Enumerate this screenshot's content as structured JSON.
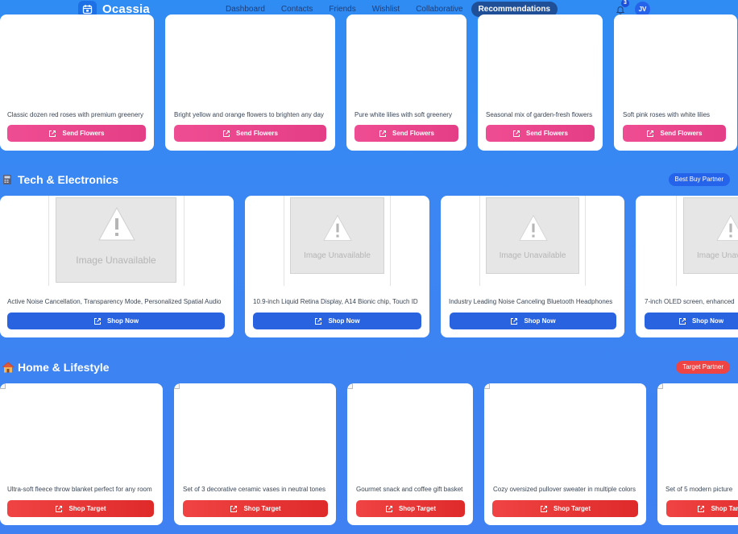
{
  "brand": {
    "name": "Ocassia"
  },
  "nav": {
    "links": [
      "Dashboard",
      "Contacts",
      "Friends",
      "Wishlist",
      "Collaborative",
      "Recommendations"
    ],
    "active": "Recommendations",
    "notification_count": "3",
    "avatar_initials": "JV"
  },
  "flowers": {
    "cards": [
      {
        "desc": "Classic dozen red roses with premium greenery",
        "button": "Send Flowers"
      },
      {
        "desc": "Bright yellow and orange flowers to brighten any day",
        "button": "Send Flowers"
      },
      {
        "desc": "Pure white lilies with soft greenery",
        "button": "Send Flowers"
      },
      {
        "desc": "Seasonal mix of garden-fresh flowers",
        "button": "Send Flowers"
      },
      {
        "desc": "Soft pink roses with white lilies",
        "button": "Send Flowers"
      }
    ]
  },
  "tech": {
    "title": "Tech & Electronics",
    "partner": "Best Buy Partner",
    "placeholder": "Image Unavailable",
    "cards": [
      {
        "desc": "Active Noise Cancellation, Transparency Mode, Personalized Spatial Audio",
        "button": "Shop Now"
      },
      {
        "desc": "10.9-inch Liquid Retina Display, A14 Bionic chip, Touch ID",
        "button": "Shop Now"
      },
      {
        "desc": "Industry Leading Noise Canceling Bluetooth Headphones",
        "button": "Shop Now"
      },
      {
        "desc": "7-inch OLED screen, enhanced",
        "button": "Shop Now"
      }
    ]
  },
  "home": {
    "title": "Home & Lifestyle",
    "partner": "Target Partner",
    "cards": [
      {
        "desc": "Ultra-soft fleece throw blanket perfect for any room",
        "button": "Shop Target"
      },
      {
        "desc": "Set of 3 decorative ceramic vases in neutral tones",
        "button": "Shop Target"
      },
      {
        "desc": "Gourmet snack and coffee gift basket",
        "button": "Shop Target"
      },
      {
        "desc": "Cozy oversized pullover sweater in multiple colors",
        "button": "Shop Target"
      },
      {
        "desc": "Set of 5 modern picture",
        "button": "Shop Target"
      }
    ]
  },
  "colors": {
    "flowers_button": "#e8438a",
    "tech_button": "#2a63e0",
    "home_button": "#e53535",
    "best_buy_badge": "#2563eb",
    "target_badge": "#ef4444"
  }
}
